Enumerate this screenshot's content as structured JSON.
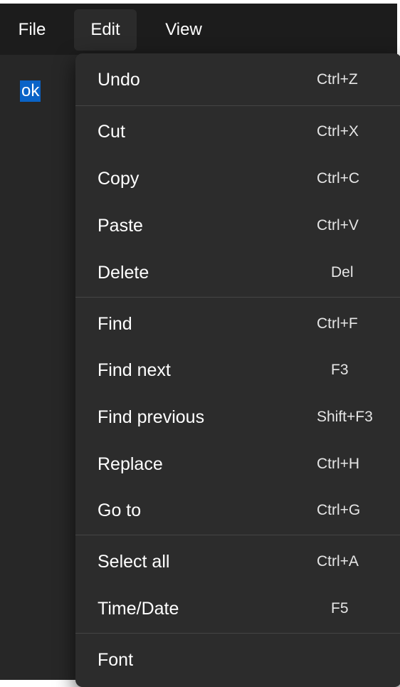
{
  "menubar": {
    "items": [
      {
        "label": "File"
      },
      {
        "label": "Edit"
      },
      {
        "label": "View"
      }
    ]
  },
  "editor": {
    "selected_text": "ok"
  },
  "edit_menu": {
    "items": [
      {
        "label": "Undo",
        "shortcut": "Ctrl+Z"
      },
      {
        "label": "Cut",
        "shortcut": "Ctrl+X"
      },
      {
        "label": "Copy",
        "shortcut": "Ctrl+C"
      },
      {
        "label": "Paste",
        "shortcut": "Ctrl+V"
      },
      {
        "label": "Delete",
        "shortcut": "Del"
      },
      {
        "label": "Find",
        "shortcut": "Ctrl+F"
      },
      {
        "label": "Find next",
        "shortcut": "F3"
      },
      {
        "label": "Find previous",
        "shortcut": "Shift+F3"
      },
      {
        "label": "Replace",
        "shortcut": "Ctrl+H"
      },
      {
        "label": "Go to",
        "shortcut": "Ctrl+G"
      },
      {
        "label": "Select all",
        "shortcut": "Ctrl+A"
      },
      {
        "label": "Time/Date",
        "shortcut": "F5"
      },
      {
        "label": "Font",
        "shortcut": ""
      }
    ]
  },
  "colors": {
    "menubar_background": "#1c1c1c",
    "editor_background": "#272727",
    "menu_background": "#2c2c2c",
    "selection_highlight": "#0a63c7",
    "text": "#ffffff",
    "separator": "#454545"
  }
}
